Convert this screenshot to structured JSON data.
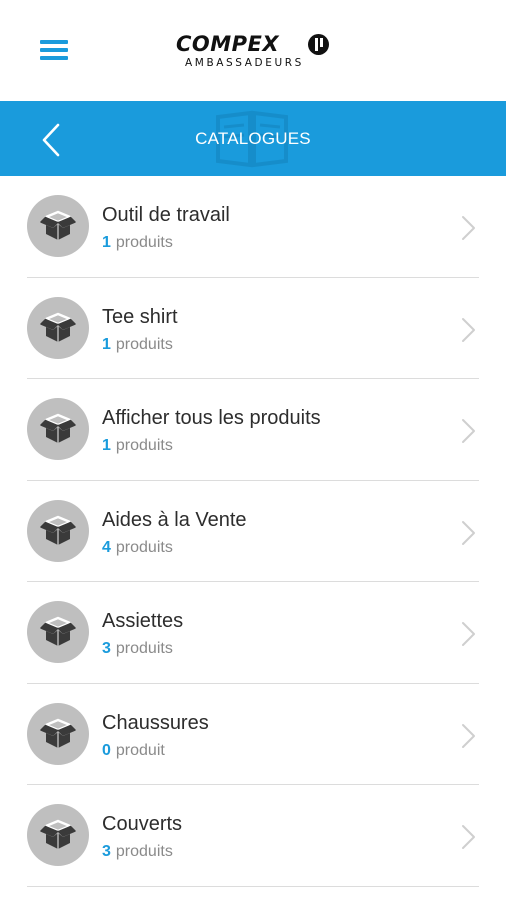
{
  "header": {
    "menu_icon": "hamburger-menu-icon",
    "logo": {
      "main": "COMPEX",
      "sub": "AMBASSADEURS"
    }
  },
  "navbar": {
    "title": "CATALOGUES",
    "back_icon": "chevron-left-icon",
    "background_color": "#1a9bdc"
  },
  "catalogues": [
    {
      "title": "Outil de travail",
      "count": "1",
      "unit": "produits"
    },
    {
      "title": "Tee shirt",
      "count": "1",
      "unit": "produits"
    },
    {
      "title": "Afficher tous les produits",
      "count": "1",
      "unit": "produits"
    },
    {
      "title": "Aides à la Vente",
      "count": "4",
      "unit": "produits"
    },
    {
      "title": "Assiettes",
      "count": "3",
      "unit": "produits"
    },
    {
      "title": "Chaussures",
      "count": "0",
      "unit": "produit"
    },
    {
      "title": "Couverts",
      "count": "3",
      "unit": "produits"
    }
  ],
  "row_icon": "open-box-icon",
  "row_chevron": "chevron-right-icon"
}
